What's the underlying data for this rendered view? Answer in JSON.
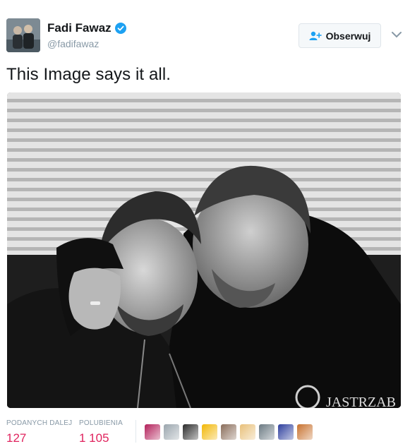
{
  "user": {
    "display_name": "Fadi Fawaz",
    "handle": "@fadifawaz",
    "verified": true,
    "avatar_icon": "user-avatar"
  },
  "follow_button": {
    "label": "Obserwuj",
    "icon": "follow-person-plus-icon"
  },
  "menu_icon": "chevron-down-icon",
  "tweet": {
    "text": "This Image says it all.",
    "photo_watermark": "JASTRZAB"
  },
  "stats": {
    "retweets_label": "PODANYCH DALEJ",
    "retweets_value": "127",
    "likes_label": "POLUBIENIA",
    "likes_value": "1 105"
  },
  "likers": [
    {
      "name": "liker-1",
      "color": "#b3205a"
    },
    {
      "name": "liker-2",
      "color": "#9aa5ad"
    },
    {
      "name": "liker-3",
      "color": "#2b2b2b"
    },
    {
      "name": "liker-4",
      "color": "#f2b705"
    },
    {
      "name": "liker-5",
      "color": "#8a6d5a"
    },
    {
      "name": "liker-6",
      "color": "#e8c07a"
    },
    {
      "name": "liker-7",
      "color": "#6b7a83"
    },
    {
      "name": "liker-8",
      "color": "#2e3f9e"
    },
    {
      "name": "liker-9",
      "color": "#c8722f"
    }
  ],
  "colors": {
    "accent": "#1da1f2",
    "like": "#e0245e",
    "muted": "#8899a6"
  }
}
